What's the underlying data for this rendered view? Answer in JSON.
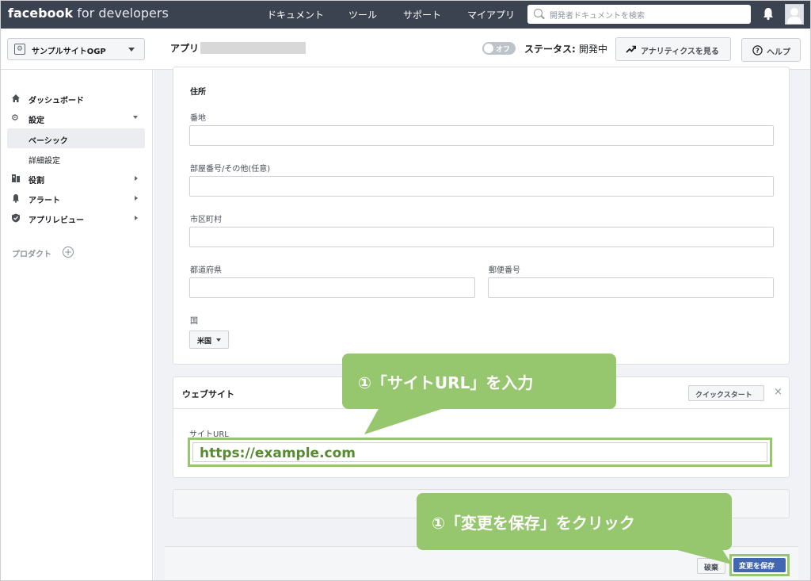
{
  "topbar": {
    "brand_bold": "facebook",
    "brand_rest": " for developers",
    "nav": [
      "ドキュメント",
      "ツール",
      "サポート",
      "マイアプリ"
    ],
    "search_placeholder": "開発者ドキュメントを検索"
  },
  "appbar": {
    "app_selector": "サンプルサイトOGP",
    "app_label": "アプリ",
    "toggle_label": "オフ",
    "status_label": "ステータス: ",
    "status_value": "開発中",
    "analytics_button": "アナリティクスを見る",
    "help_button": "ヘルプ"
  },
  "sidebar": {
    "items": [
      {
        "label": "ダッシュボード",
        "icon": "home-icon"
      },
      {
        "label": "設定",
        "icon": "gear-icon"
      },
      {
        "label": "ベーシック",
        "active": true
      },
      {
        "label": "詳細設定"
      },
      {
        "label": "役割",
        "icon": "roles-icon"
      },
      {
        "label": "アラート",
        "icon": "bell-icon"
      },
      {
        "label": "アプリレビュー",
        "icon": "shield-check-icon"
      }
    ],
    "products_label": "プロダクト"
  },
  "address": {
    "section_title": "住所",
    "street_label": "番地",
    "room_label": "部屋番号/その他(任意)",
    "city_label": "市区町村",
    "prefecture_label": "都道府県",
    "postal_label": "郵便番号",
    "country_label": "国",
    "country_value": "米国"
  },
  "website": {
    "title": "ウェブサイト",
    "quickstart_button": "クイックスタート",
    "site_url_label": "サイトURL",
    "site_url_value": "https://example.com"
  },
  "footer": {
    "discard_button": "破棄",
    "save_button": "変更を保存"
  },
  "annotations": {
    "callout_url": "①「サイトURL」を入力",
    "callout_save": "①「変更を保存」をクリック",
    "color": "#96c66d"
  }
}
